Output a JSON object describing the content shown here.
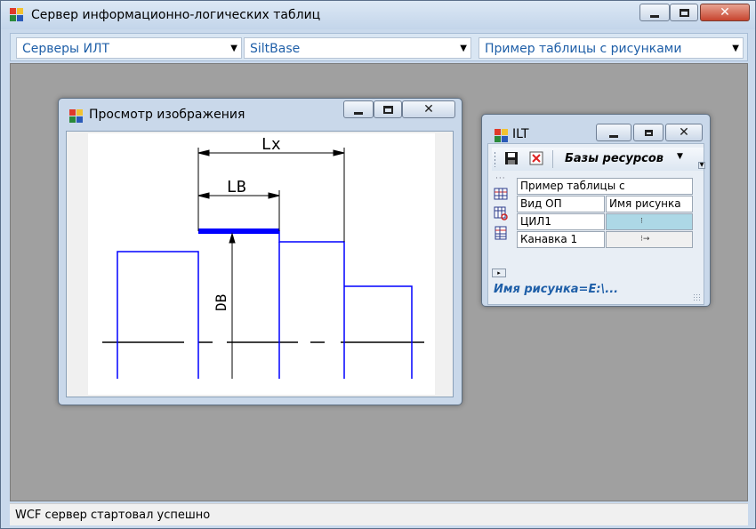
{
  "main_window": {
    "title": "Сервер информационно-логических таблиц",
    "toolbar": {
      "combo_servers": "Серверы ИЛТ",
      "combo_base": "SiltBase",
      "combo_table": "Пример таблицы с рисунками"
    },
    "status": "WCF сервер стартовал успешно"
  },
  "image_viewer": {
    "title": "Просмотр изображения",
    "drawing_labels": {
      "lx": "Lx",
      "lb": "LB",
      "db": "DB"
    },
    "colors": {
      "profile_line": "#0000ff",
      "highlight": "#0000ff",
      "dimension": "#000000"
    }
  },
  "ilt_window": {
    "title": "ILT",
    "resources_label": "Базы ресурсов",
    "table": {
      "header_title": "Пример таблицы с",
      "columns": [
        "Вид ОП",
        "Имя рисунка"
      ],
      "rows": [
        "ЦИЛ1",
        "Канавка 1"
      ]
    },
    "status": "Имя рисунка=E:\\..."
  }
}
